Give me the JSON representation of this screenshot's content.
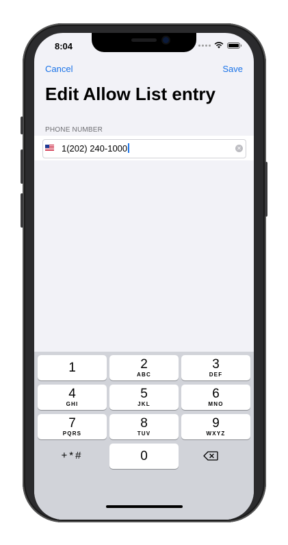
{
  "status": {
    "time": "8:04"
  },
  "nav": {
    "cancel_label": "Cancel",
    "save_label": "Save"
  },
  "page": {
    "title": "Edit Allow List entry"
  },
  "form": {
    "section_header": "PHONE NUMBER",
    "phone_value": "1(202) 240-1000",
    "flag": "us-flag-icon"
  },
  "keypad": {
    "keys": [
      {
        "num": "1",
        "letters": ""
      },
      {
        "num": "2",
        "letters": "ABC"
      },
      {
        "num": "3",
        "letters": "DEF"
      },
      {
        "num": "4",
        "letters": "GHI"
      },
      {
        "num": "5",
        "letters": "JKL"
      },
      {
        "num": "6",
        "letters": "MNO"
      },
      {
        "num": "7",
        "letters": "PQRS"
      },
      {
        "num": "8",
        "letters": "TUV"
      },
      {
        "num": "9",
        "letters": "WXYZ"
      }
    ],
    "symbols_label": "+*#",
    "zero": "0"
  },
  "colors": {
    "accent": "#1a73e8",
    "background": "#f2f2f7",
    "keyboard": "#d1d3d9"
  }
}
